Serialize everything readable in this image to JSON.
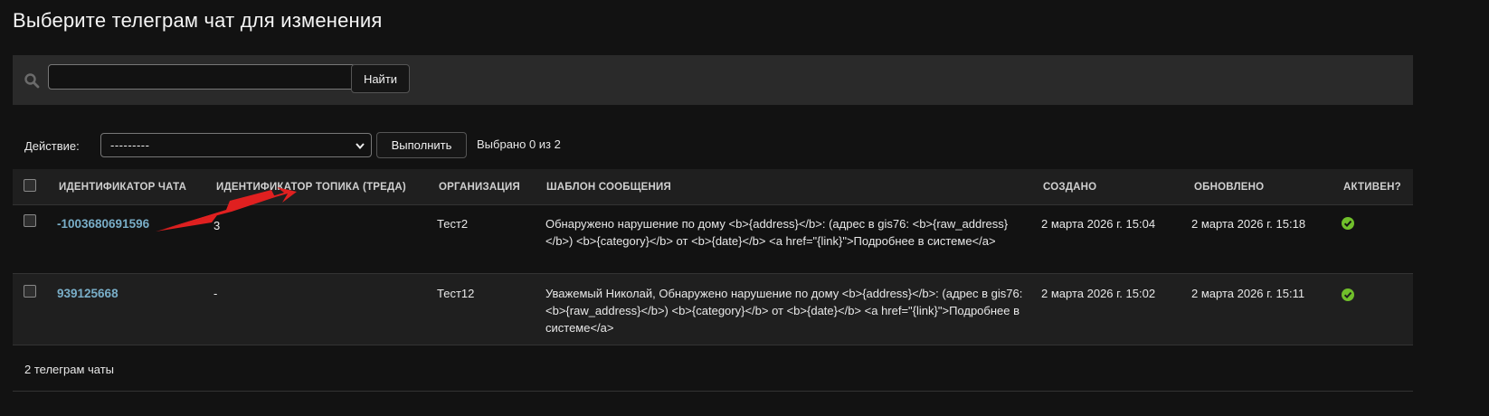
{
  "page": {
    "title": "Выберите телеграм чат для изменения"
  },
  "search": {
    "icon": "search-icon",
    "value": "",
    "placeholder": "",
    "button_label": "Найти"
  },
  "actions": {
    "label": "Действие:",
    "selected_option": "---------",
    "run_label": "Выполнить",
    "selection_counter": "Выбрано 0 из 2"
  },
  "table": {
    "columns": [
      "Идентификатор чата",
      "Идентификатор топика (треда)",
      "Организация",
      "Шаблон сообщения",
      "Создано",
      "Обновлено",
      "Активен?"
    ],
    "rows": [
      {
        "chat_id": "-1003680691596",
        "topic_id": "3",
        "organization": "Тест2",
        "template": "Обнаружено нарушение по дому <b>{address}</b>: (адрес в gis76: <b>{raw_address}</b>) <b>{category}</b> от <b>{date}</b> <a href=\"{link}\">Подробнее в системе</a>",
        "created": "2 марта 2026 г. 15:04",
        "updated": "2 марта 2026 г. 15:18",
        "active": true
      },
      {
        "chat_id": "939125668",
        "topic_id": "-",
        "organization": "Тест12",
        "template": "Уважемый Николай, Обнаружено нарушение по дому <b>{address}</b>: (адрес в gis76: <b>{raw_address}</b>) <b>{category}</b> от <b>{date}</b> <a href=\"{link}\">Подробнее в системе</a>",
        "created": "2 марта 2026 г. 15:02",
        "updated": "2 марта 2026 г. 15:11",
        "active": true
      }
    ],
    "footer": "2 телеграм чаты"
  },
  "colors": {
    "background": "#121212",
    "link": "#79aec8",
    "active_icon": "#70bf2b",
    "annotation_arrow": "#e02020"
  }
}
